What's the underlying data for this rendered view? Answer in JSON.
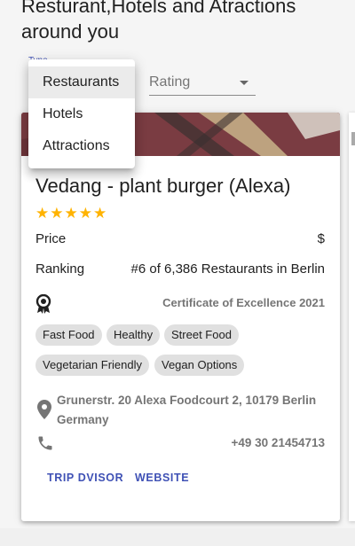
{
  "page": {
    "heading": "Resturant,Hotels and Atractions\naround you"
  },
  "filters": {
    "type_label": "Type",
    "type_options": [
      "Restaurants",
      "Hotels",
      "Attractions"
    ],
    "type_selected": "Restaurants",
    "rating_placeholder": "Rating"
  },
  "place": {
    "name": "Vedang - plant burger (Alexa)",
    "rating_stars": 5,
    "stars_text": "★★★★★",
    "price_label": "Price",
    "price_value": "$",
    "ranking_label": "Ranking",
    "ranking_value": "#6 of 6,386 Restaurants in Berlin",
    "certificate": "Certificate of Excellence 2021",
    "tags": [
      "Fast Food",
      "Healthy",
      "Street Food",
      "Vegetarian Friendly",
      "Vegan Options"
    ],
    "address_line1": "Grunerstr. 20 Alexa Foodcourt 2, 10179 Berlin",
    "address_line2": "Germany",
    "phone": "+49 30 21454713",
    "actions": {
      "tripadvisor": "TRIP DVISOR",
      "website": "WEBSITE"
    }
  },
  "icons": {
    "certificate": "award-icon",
    "address": "location-pin-icon",
    "phone": "phone-icon",
    "dropdown": "arrow-drop-down-icon"
  },
  "colors": {
    "accent": "#3f51b5",
    "star": "#ffb300",
    "chip_bg": "#e0e0e0",
    "secondary_text": "#757575"
  }
}
